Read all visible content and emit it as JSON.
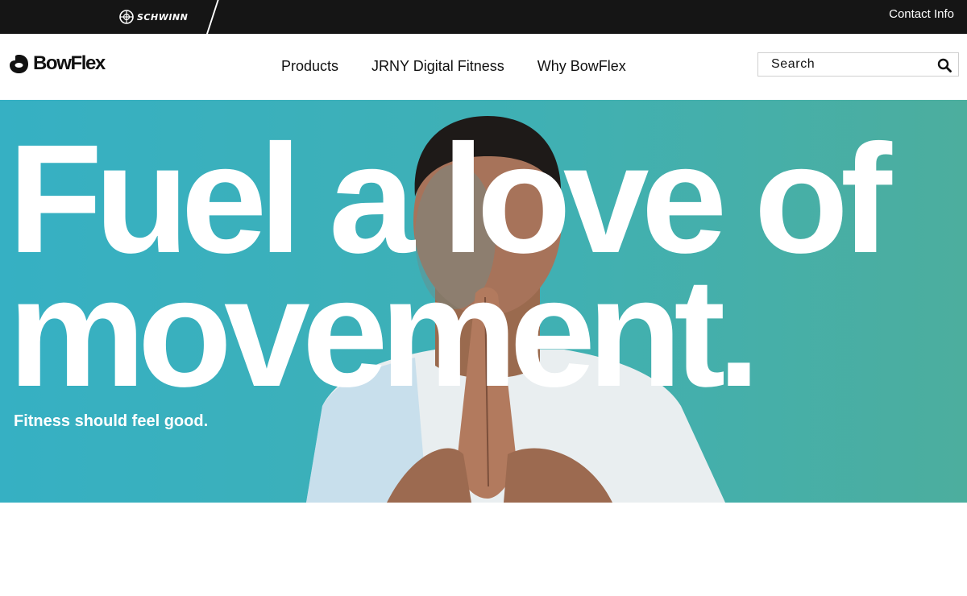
{
  "topbar": {
    "sister_brand": "SCHWINN",
    "contact_label": "Contact Info"
  },
  "header": {
    "brand": "BowFlex",
    "nav": [
      {
        "label": "Products"
      },
      {
        "label": "JRNY Digital Fitness"
      },
      {
        "label": "Why BowFlex"
      }
    ],
    "search": {
      "placeholder": "Search",
      "value": "",
      "icon": "search-icon"
    }
  },
  "hero": {
    "headline_line1": "Fuel a love of",
    "headline_line2": "movement.",
    "subhead": "Fitness should feel good."
  },
  "colors": {
    "topbar_bg": "#151515",
    "hero_teal": "#3fb0b4",
    "text_dark": "#111111",
    "hero_text": "#ffffff"
  }
}
